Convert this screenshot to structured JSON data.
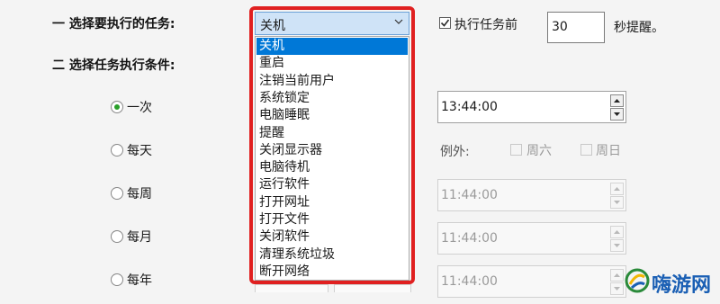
{
  "section1": {
    "label": "一 选择要执行的任务:"
  },
  "task_combo": {
    "value": "关机",
    "options": [
      "关机",
      "重启",
      "注销当前用户",
      "系统锁定",
      "电脑睡眠",
      "提醒",
      "关闭显示器",
      "电脑待机",
      "运行软件",
      "打开网址",
      "打开文件",
      "关闭软件",
      "清理系统垃圾",
      "断开网络"
    ],
    "selected_index": 0
  },
  "remind": {
    "label": "执行任务前",
    "checked": true,
    "minutes": "30",
    "suffix": "秒提醒。"
  },
  "section2": {
    "label": "二 选择任务执行条件:"
  },
  "conditions": [
    {
      "label": "一次",
      "selected": true
    },
    {
      "label": "每天",
      "selected": false
    },
    {
      "label": "每周",
      "selected": false
    },
    {
      "label": "每月",
      "selected": false
    },
    {
      "label": "每年",
      "selected": false
    }
  ],
  "times": [
    "13:44:00",
    "11:44:00",
    "11:44:00",
    "11:44:00"
  ],
  "exceptions": {
    "label": "例外:",
    "saturday": "周六",
    "sunday": "周日"
  },
  "watermark": {
    "text": "嗨游网"
  },
  "colors": {
    "highlight": "#e02020",
    "selection": "#0078d7",
    "radio_dot": "#2aa02a"
  }
}
